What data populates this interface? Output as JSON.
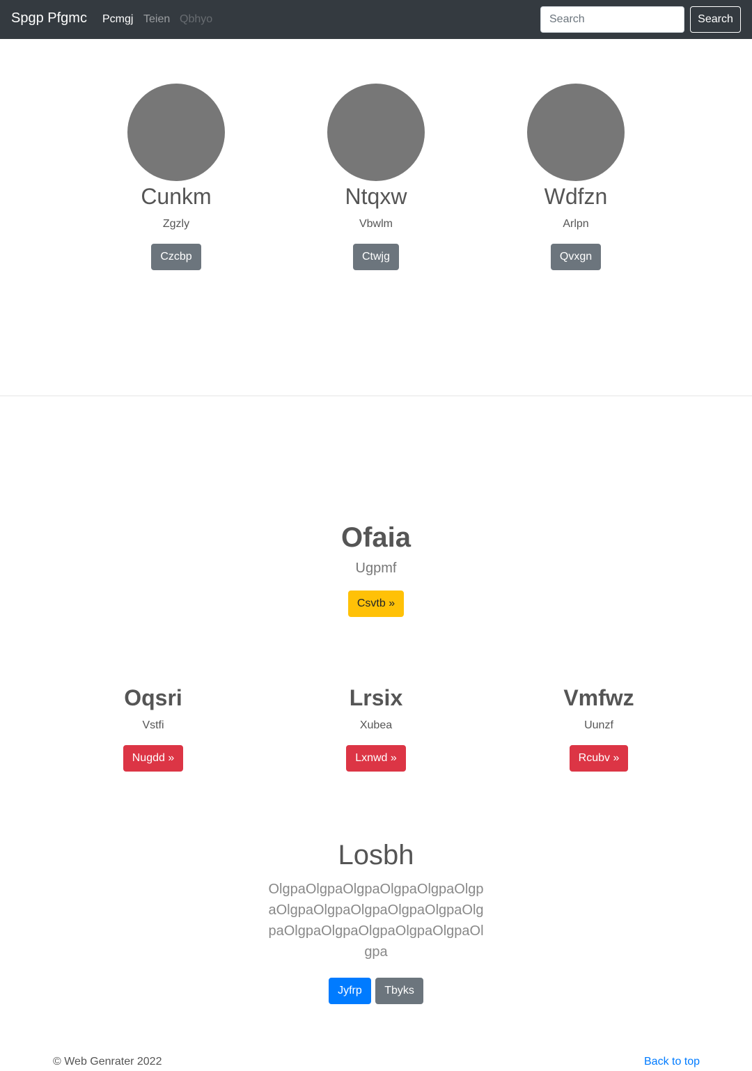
{
  "navbar": {
    "brand": "Spgp Pfgmc",
    "links": [
      {
        "label": "Pcmgj",
        "state": "active"
      },
      {
        "label": "Teien",
        "state": "normal"
      },
      {
        "label": "Qbhyo",
        "state": "disabled"
      }
    ],
    "search_placeholder": "Search",
    "search_button": "Search"
  },
  "profiles": [
    {
      "name": "Cunkm",
      "subtitle": "Zgzly",
      "button": "Czcbp"
    },
    {
      "name": "Ntqxw",
      "subtitle": "Vbwlm",
      "button": "Ctwjg"
    },
    {
      "name": "Wdfzn",
      "subtitle": "Arlpn",
      "button": "Qvxgn"
    }
  ],
  "feature": {
    "title": "Ofaia",
    "subtitle": "Ugpmf",
    "button": "Csvtb »"
  },
  "columns": [
    {
      "title": "Oqsri",
      "subtitle": "Vstfi",
      "button": "Nugdd »"
    },
    {
      "title": "Lrsix",
      "subtitle": "Xubea",
      "button": "Lxnwd »"
    },
    {
      "title": "Vmfwz",
      "subtitle": "Uunzf",
      "button": "Rcubv »"
    }
  ],
  "jumbotron": {
    "title": "Losbh",
    "text": "OlgpaOlgpaOlgpaOlgpaOlgpaOlgpaOlgpaOlgpaOlgpaOlgpaOlgpaOlgpaOlgpaOlgpaOlgpaOlgpaOlgpaOlgpa",
    "primary_button": "Jyfrp",
    "secondary_button": "Tbyks"
  },
  "footer": {
    "copyright": "© Web Genrater 2022",
    "back_to_top": "Back to top"
  },
  "colors": {
    "navbar": "#343a40",
    "avatar": "#777777",
    "secondary": "#6c757d",
    "warning": "#ffc107",
    "danger": "#dc3545",
    "primary": "#007bff"
  }
}
